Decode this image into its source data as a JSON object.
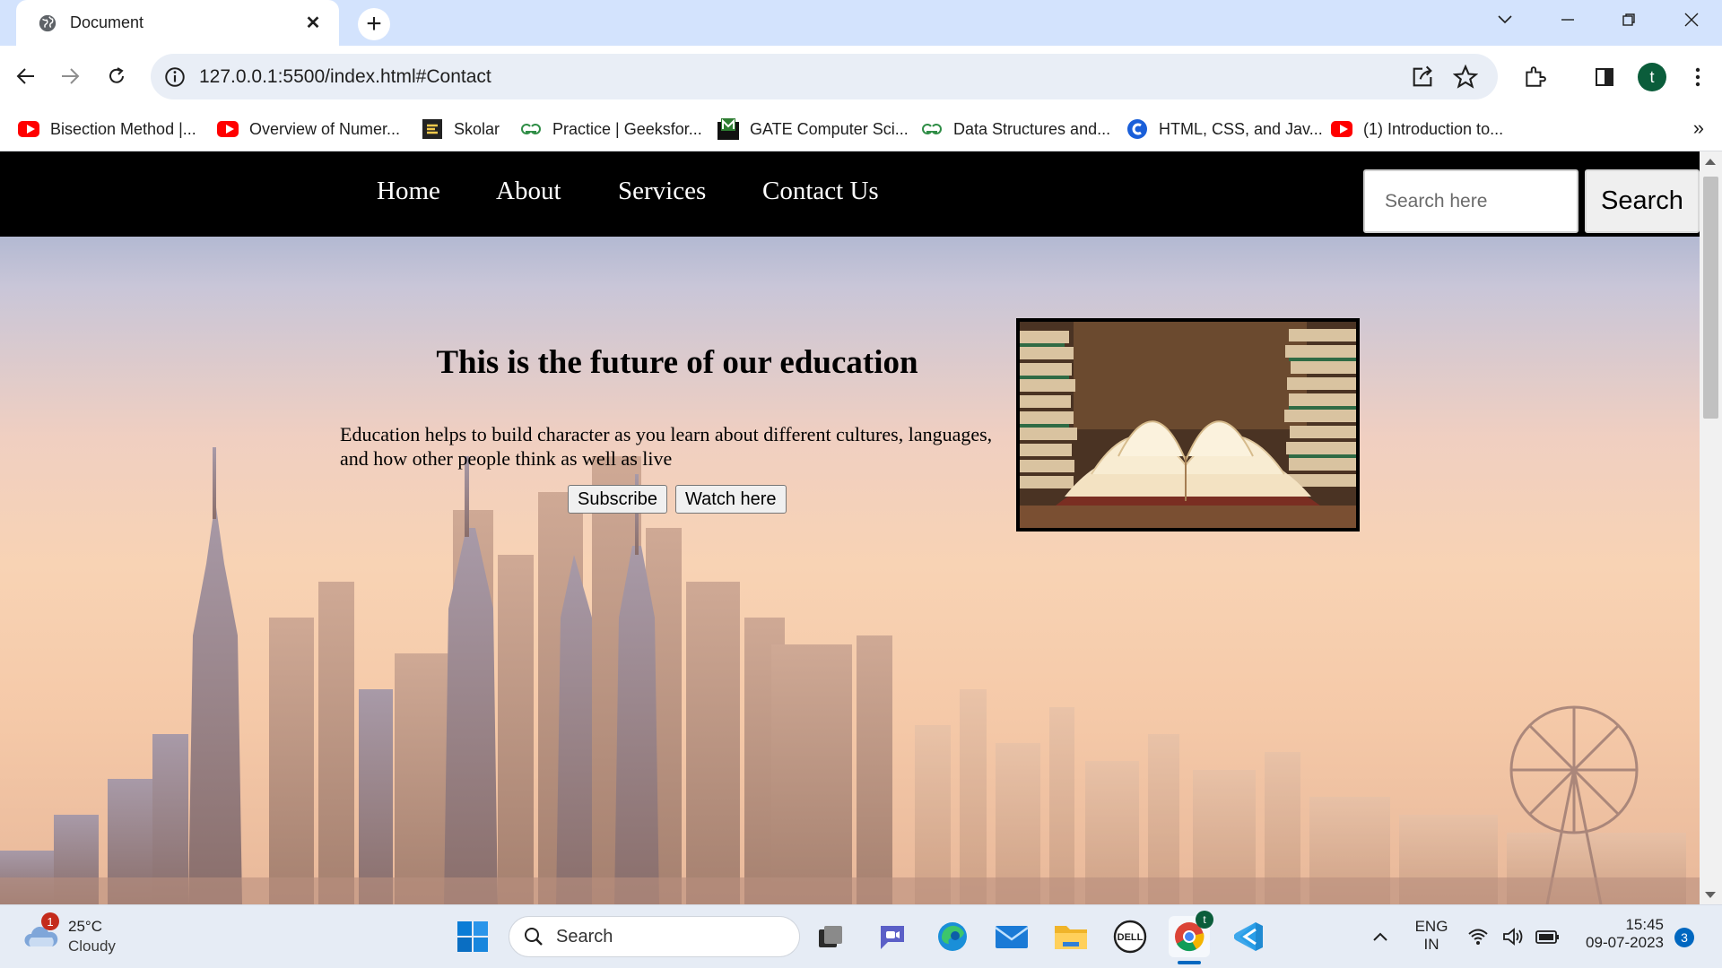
{
  "browser": {
    "tab_title": "Document",
    "url": "127.0.0.1:5500/index.html#Contact",
    "profile_initial": "t",
    "bookmarks": [
      {
        "label": "Bisection Method |...",
        "icon": "youtube-icon"
      },
      {
        "label": "Overview of Numer...",
        "icon": "youtube-icon"
      },
      {
        "label": "Skolar",
        "icon": "skolar-icon"
      },
      {
        "label": "Practice | Geeksfor...",
        "icon": "geeksforgeeks-icon"
      },
      {
        "label": "GATE Computer Sci...",
        "icon": "gate-icon"
      },
      {
        "label": "Data Structures and...",
        "icon": "geeksforgeeks-icon"
      },
      {
        "label": "HTML, CSS, and Jav...",
        "icon": "c-icon"
      },
      {
        "label": "(1) Introduction to...",
        "icon": "youtube-icon"
      }
    ],
    "more_bookmarks": "»"
  },
  "site": {
    "nav": [
      "Home",
      "About",
      "Services",
      "Contact Us"
    ],
    "search_placeholder": "Search here",
    "search_button": "Search",
    "headline": "This is the future of our education",
    "paragraph": "Education helps to build character as you learn about different cultures, languages, and how other people think as well as live",
    "subscribe_button": "Subscribe",
    "watch_button": "Watch here"
  },
  "taskbar": {
    "temperature": "25°C",
    "condition": "Cloudy",
    "weather_badge": "1",
    "search_label": "Search",
    "chrome_badge": "t",
    "language": "ENG",
    "region": "IN",
    "time": "15:45",
    "date": "09-07-2023",
    "notifications": "3"
  },
  "colors": {
    "tabbar": "#d3e3fd",
    "site_nav": "#000000",
    "accent": "#0067c0"
  }
}
